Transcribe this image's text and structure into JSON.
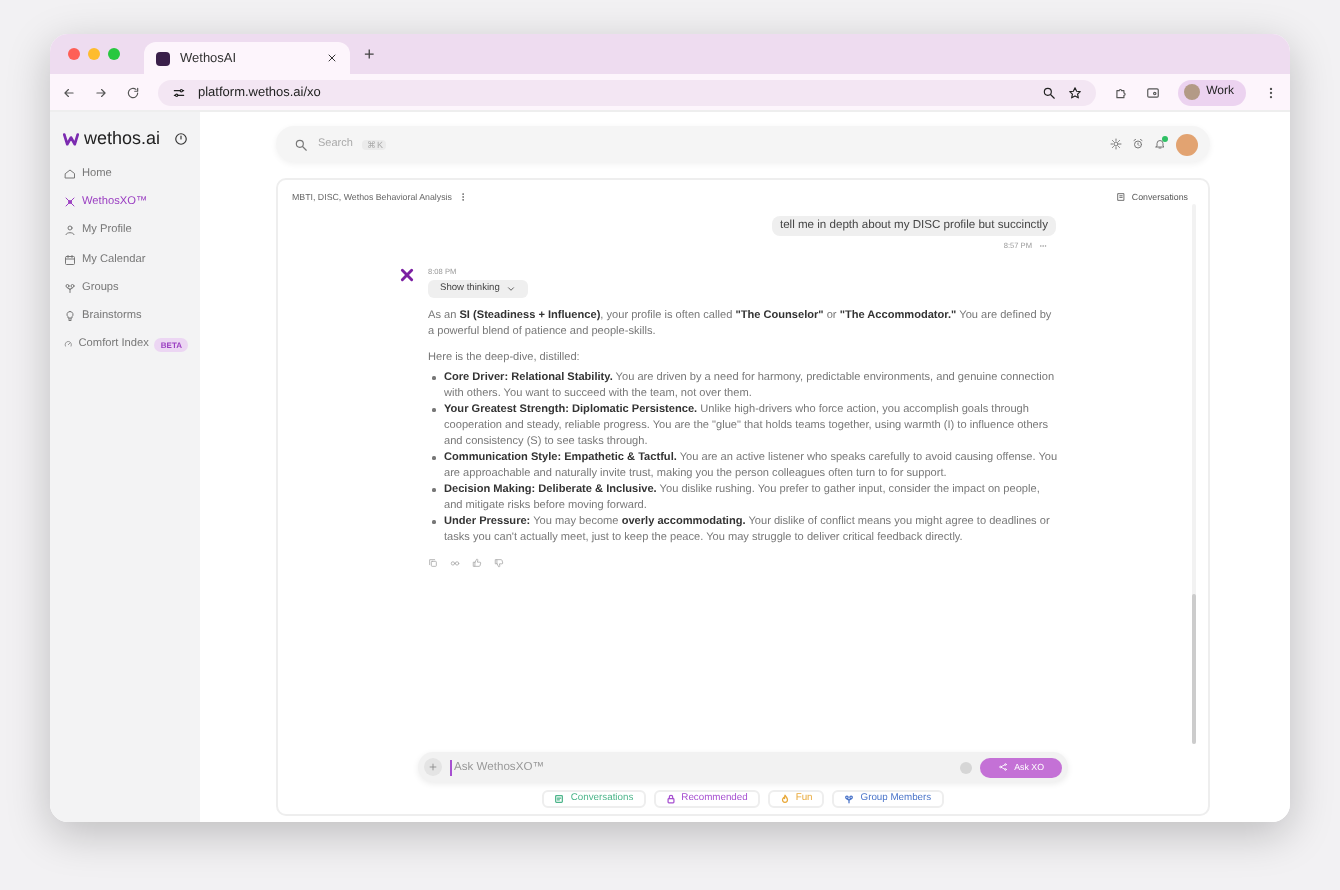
{
  "browser": {
    "tab_title": "WethosAI",
    "new_tab": "+",
    "url": "platform.wethos.ai/xo",
    "profile": "Work"
  },
  "sidebar": {
    "logo": "wethos.ai",
    "items": [
      {
        "label": "Home",
        "selected": false
      },
      {
        "label": "WethosXO™",
        "selected": true
      },
      {
        "label": "My Profile",
        "selected": false
      },
      {
        "label": "My Calendar",
        "selected": false
      },
      {
        "label": "Groups",
        "selected": false
      },
      {
        "label": "Brainstorms",
        "selected": false
      },
      {
        "label": "Comfort Index",
        "selected": false,
        "badge": "BETA"
      }
    ]
  },
  "search": {
    "placeholder": "Search",
    "shortcut": "⌘K"
  },
  "chat": {
    "context": "MBTI, DISC, Wethos Behavioral Analysis",
    "conversations_button": "Conversations",
    "user_message": {
      "text": "tell me in depth about my DISC profile but succinctly",
      "time": "8:57 PM"
    },
    "assistant_message": {
      "time": "8:08 PM",
      "show_thinking": "Show thinking",
      "paragraphs": [
        "As an **SI (Steadiness + Influence)**, your profile is often called **\"The Counselor\"** or **\"The Accommodator.\"** You are defined by a powerful blend of patience and people-skills.",
        "Here is the deep-dive, distilled:"
      ],
      "bullets": [
        "**Core Driver: Relational Stability.** You are driven by a need for harmony, predictable environments, and genuine connection with others. You want to succeed with the team, not over them.",
        "**Your Greatest Strength: Diplomatic Persistence.** Unlike high-drivers who force action, you accomplish goals through cooperation and steady, reliable progress. You are the \"glue\" that holds teams together, using warmth (I) to influence others and consistency (S) to see tasks through.",
        "**Communication Style: Empathetic & Tactful.** You are an active listener who speaks carefully to avoid causing offense. You are approachable and naturally invite trust, making you the person colleagues often turn to for support.",
        "**Decision Making: Deliberate & Inclusive.** You dislike rushing. You prefer to gather input, consider the impact on people, and mitigate risks before moving forward.",
        "**Under Pressure:** You may become **overly accommodating.** Your dislike of conflict means you might agree to deadlines or tasks you can't actually meet, just to keep the peace. You may struggle to deliver critical feedback directly."
      ]
    },
    "composer": {
      "placeholder": "Ask WethosXO™",
      "send_button": "Ask XO"
    },
    "chips": [
      {
        "label": "Conversations",
        "color": "#4cb58a"
      },
      {
        "label": "Recommended",
        "color": "#a64fd0"
      },
      {
        "label": "Fun",
        "color": "#e8a93a"
      },
      {
        "label": "Group Members",
        "color": "#4a74c9"
      }
    ]
  }
}
